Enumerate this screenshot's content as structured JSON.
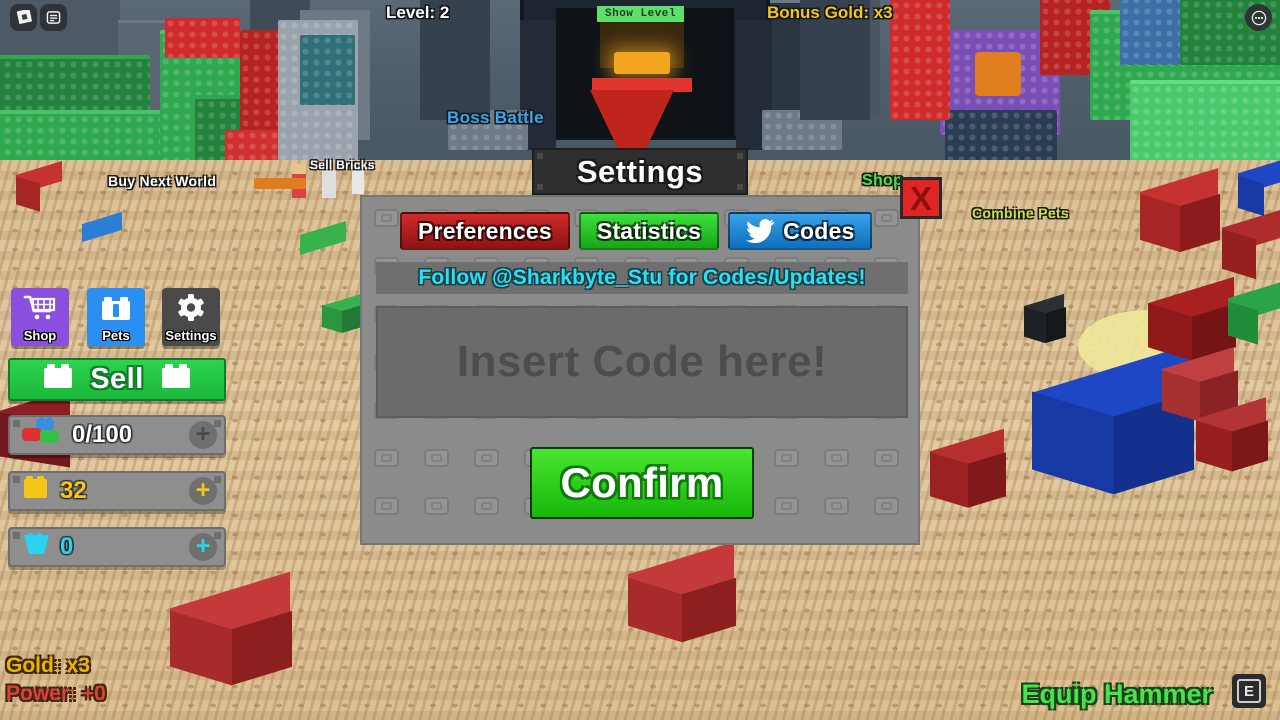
{
  "top_hud": {
    "roblox_icon": "roblox-logo-icon",
    "chat_icon": "chat-icon",
    "more_icon": "more-options-icon",
    "level_label": "Level: 2",
    "bonus_gold_label": "Bonus Gold: x3",
    "show_level_sign": "Show Level"
  },
  "world_labels": [
    {
      "text": "Buy Next World",
      "color": "#ffffff"
    },
    {
      "text": "Sell Bricks",
      "color": "#ffffff"
    },
    {
      "text": "Boss Battle",
      "color": "#3aa6f0"
    },
    {
      "text": "Shop",
      "color": "#49e04e"
    },
    {
      "text": "Combine Pets",
      "color": "#c8e04a"
    }
  ],
  "left_hud": {
    "buttons": [
      {
        "label": "Shop",
        "icon": "shopping-cart-icon",
        "color": "#8b4fe0"
      },
      {
        "label": "Pets",
        "icon": "pet-brick-icon",
        "color": "#2a8ff0"
      },
      {
        "label": "Settings",
        "icon": "gear-icon",
        "color": "#4a4a4a"
      }
    ],
    "sell_button": {
      "label": "Sell",
      "icon": "brick-icon"
    },
    "counters": [
      {
        "name": "bricks",
        "icon": "bricks-icon",
        "value": "0/100",
        "color": "#ffffff",
        "plus_color": "#5a5a5a"
      },
      {
        "name": "gold",
        "icon": "gold-brick-icon",
        "value": "32",
        "color": "#f5c518",
        "plus_color": "#f5c518"
      },
      {
        "name": "gems",
        "icon": "gem-icon",
        "value": "0",
        "color": "#2ad4f0",
        "plus_color": "#2ad4f0"
      }
    ]
  },
  "bottom_left_stats": [
    {
      "text": "Gold: x3",
      "color": "#f0b400"
    },
    {
      "text": "Power: +0",
      "color": "#e33a3a"
    }
  ],
  "bottom_right": {
    "equip_label": "Equip Hammer",
    "keybind": "E"
  },
  "dialog": {
    "title": "Settings",
    "close_label": "X",
    "tabs": [
      {
        "label": "Preferences",
        "variant": "tab-pref",
        "icon": null
      },
      {
        "label": "Statistics",
        "variant": "tab-stat",
        "icon": null
      },
      {
        "label": "Codes",
        "variant": "tab-codes",
        "icon": "twitter-bird-icon"
      }
    ],
    "active_tab": "Codes",
    "follow_text": "Follow @Sharkbyte_Stu for Codes/Updates!",
    "code_input": {
      "value": "",
      "placeholder": "Insert Code here!"
    },
    "confirm_label": "Confirm"
  }
}
